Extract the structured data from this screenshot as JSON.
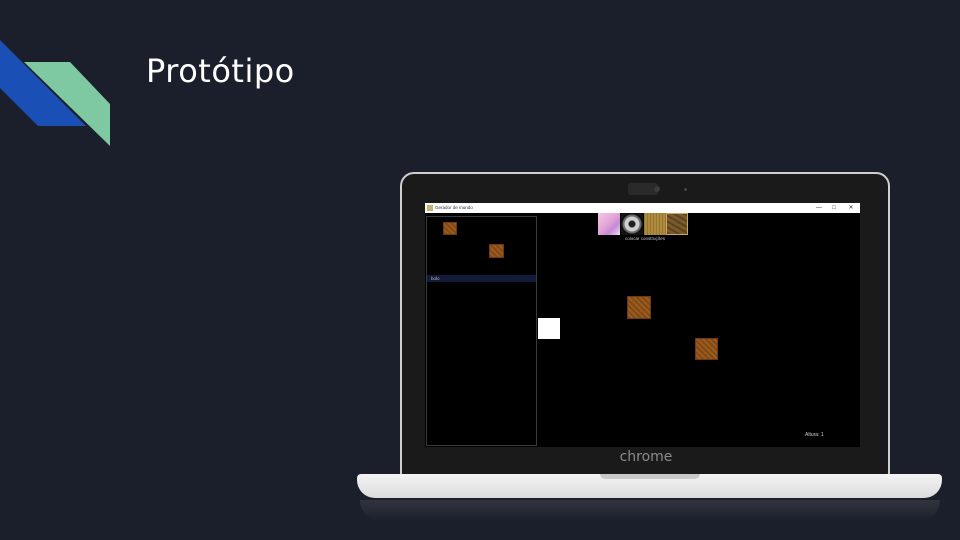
{
  "slide": {
    "title": "Protótipo"
  },
  "laptop": {
    "brand": "chrome"
  },
  "app": {
    "window_title": "Gerador de mundo",
    "controls": {
      "minimize": "—",
      "maximize": "□",
      "close": "✕"
    },
    "left_panel": {
      "selected_item": "bolo"
    },
    "palette": {
      "label": "colocar construções",
      "items": [
        "pink-texture",
        "gear-texture",
        "sand-texture",
        "rock-texture"
      ]
    },
    "status": {
      "altura": "Altura: 1"
    }
  },
  "colors": {
    "background": "#1b1f2b",
    "accent_blue": "#1a4fb5",
    "accent_green": "#7ec8a2",
    "tile_brown": "#9c5a1d"
  }
}
